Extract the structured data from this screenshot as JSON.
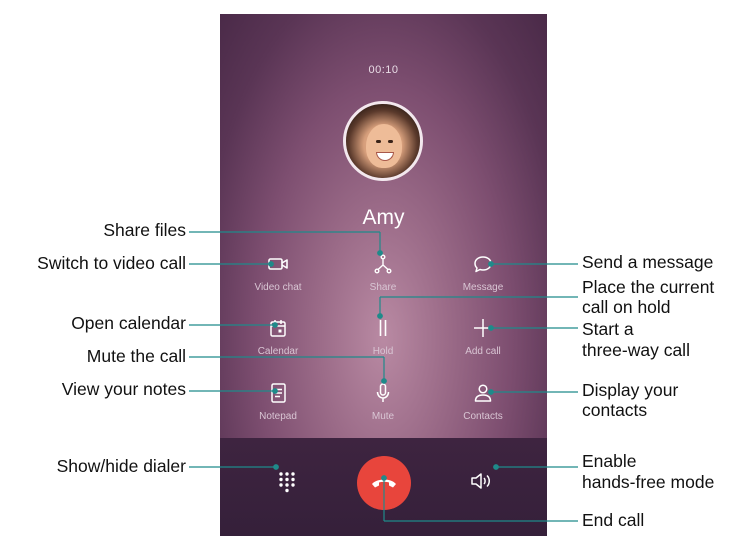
{
  "call": {
    "timer": "00:10",
    "contact_name": "Amy"
  },
  "buttons": [
    {
      "label": "Video chat",
      "icon": "video-camera-icon"
    },
    {
      "label": "Share",
      "icon": "share-icon"
    },
    {
      "label": "Message",
      "icon": "message-bubble-icon"
    },
    {
      "label": "Calendar",
      "icon": "calendar-icon"
    },
    {
      "label": "Hold",
      "icon": "pause-icon"
    },
    {
      "label": "Add call",
      "icon": "plus-icon"
    },
    {
      "label": "Notepad",
      "icon": "notepad-icon"
    },
    {
      "label": "Mute",
      "icon": "microphone-icon"
    },
    {
      "label": "Contacts",
      "icon": "person-icon"
    }
  ],
  "bottom_bar": {
    "dialer_icon": "dialpad-icon",
    "end_call_icon": "end-call-icon",
    "speaker_icon": "speaker-icon",
    "end_call_color": "#e8453c"
  },
  "annotations": {
    "share_files": "Share files",
    "switch_video": "Switch to video call",
    "open_calendar": "Open calendar",
    "mute_call": "Mute the call",
    "view_notes": "View your notes",
    "show_dialer": "Show/hide dialer",
    "send_message": "Send a message",
    "hold_line1": "Place the current",
    "hold_line2": "call on hold",
    "add_line1": "Start a",
    "add_line2": "three-way call",
    "contacts_line1": "Display your",
    "contacts_line2": "contacts",
    "speaker_line1": "Enable",
    "speaker_line2": "hands-free mode",
    "end_call": "End call"
  }
}
